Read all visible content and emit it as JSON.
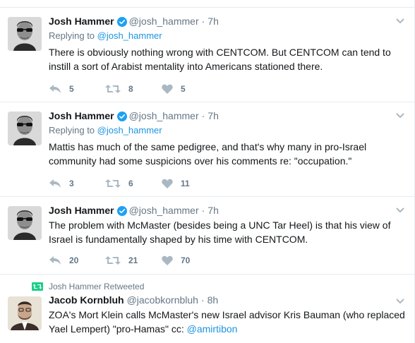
{
  "tweets": [
    {
      "fullname": "Josh Hammer",
      "handle": "@josh_hammer",
      "dot": "·",
      "time": "7h",
      "replying_prefix": "Replying to ",
      "replying_to": "@josh_hammer",
      "text": "There is obviously nothing wrong with CENTCOM. But CENTCOM can tend to instill a sort of Arabist mentality into Americans stationed there.",
      "replies": "5",
      "retweets": "8",
      "likes": "5"
    },
    {
      "fullname": "Josh Hammer",
      "handle": "@josh_hammer",
      "dot": "·",
      "time": "7h",
      "replying_prefix": "Replying to ",
      "replying_to": "@josh_hammer",
      "text": "Mattis has much of the same pedigree, and that's why many in pro-Israel community had some suspicions over his comments re: \"occupation.\"",
      "replies": "3",
      "retweets": "6",
      "likes": "11"
    },
    {
      "fullname": "Josh Hammer",
      "handle": "@josh_hammer",
      "dot": "·",
      "time": "7h",
      "text": "The problem with McMaster (besides being a UNC Tar Heel) is that his view of Israel is fundamentally shaped by his time with CENTCOM.",
      "replies": "20",
      "retweets": "21",
      "likes": "70"
    },
    {
      "retweeted_by": "Josh Hammer Retweeted",
      "fullname": "Jacob Kornbluh",
      "handle": "@jacobkornbluh",
      "dot": "·",
      "time": "8h",
      "text": "ZOA's Mort Klein calls McMaster's new Israel advisor Kris Bauman (who replaced Yael Lempert) \"pro-Hamas\" cc: ",
      "mention": "@amirtibon"
    }
  ],
  "colors": {
    "link": "#1b95e0",
    "verified": "#1da1f2",
    "retweet_green": "#19cf86",
    "muted": "#657786",
    "icon": "#aab8c2"
  },
  "icons": {
    "reply": "reply-icon",
    "retweet": "retweet-icon",
    "like": "heart-icon",
    "verified": "verified-badge-icon",
    "caret": "chevron-down-icon"
  }
}
